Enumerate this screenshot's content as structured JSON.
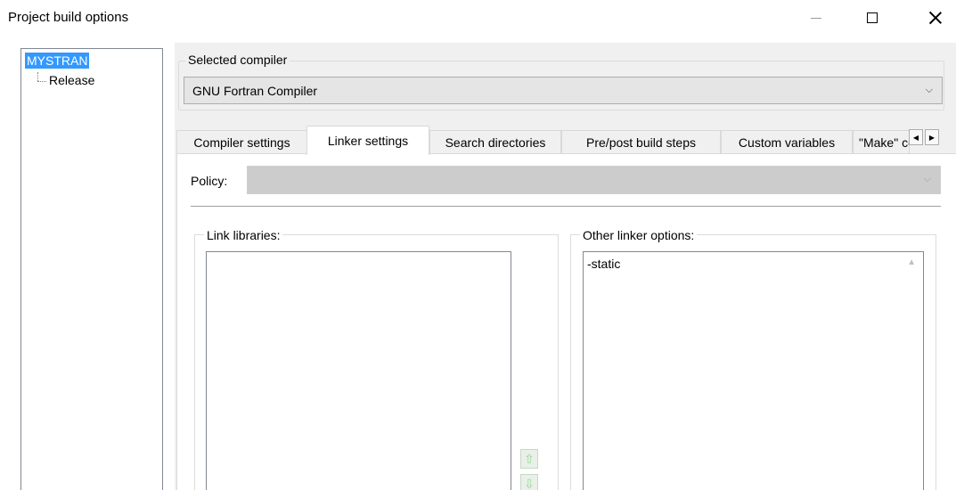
{
  "window": {
    "title": "Project build options",
    "minimize_label": "",
    "maximize_label": "",
    "close_label": ""
  },
  "tree": {
    "root": "MYSTRAN",
    "children": [
      "Release"
    ]
  },
  "compiler": {
    "group_label": "Selected compiler",
    "selected": "GNU Fortran Compiler"
  },
  "tabs": [
    {
      "label": "Compiler settings",
      "active": false
    },
    {
      "label": "Linker settings",
      "active": true
    },
    {
      "label": "Search directories",
      "active": false
    },
    {
      "label": "Pre/post build steps",
      "active": false
    },
    {
      "label": "Custom variables",
      "active": false
    },
    {
      "label": "\"Make\" commands",
      "active": false
    }
  ],
  "tab_scroll": {
    "left": "◀",
    "right": "▶"
  },
  "linker": {
    "policy_label": "Policy:",
    "policy_value": "",
    "link_libraries_label": "Link libraries:",
    "link_libraries": [],
    "other_options_label": "Other linker options:",
    "other_options_value": "-static"
  },
  "icons": {
    "dropdown": "chevron-down-icon",
    "move_up": "green-up-arrow-icon",
    "move_down": "green-down-arrow-icon"
  }
}
